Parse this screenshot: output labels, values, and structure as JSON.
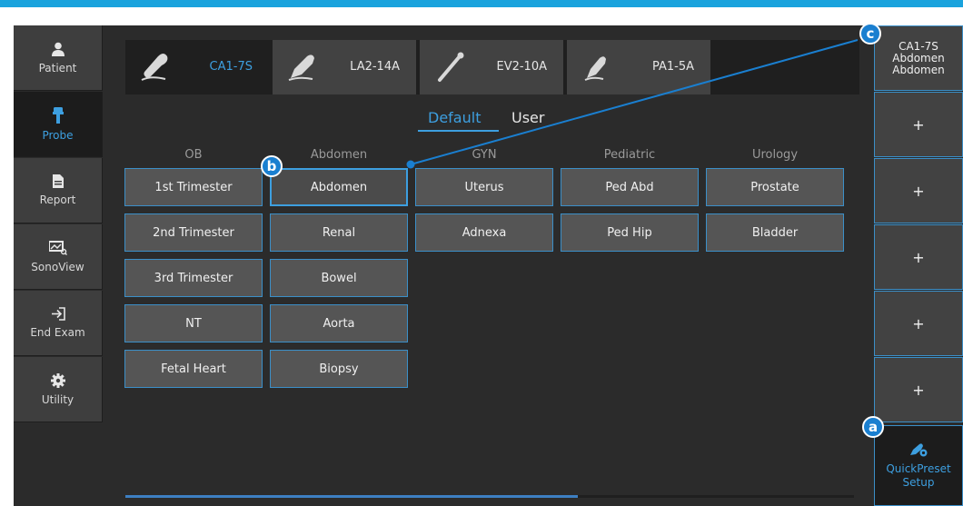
{
  "sidebar": {
    "items": [
      {
        "label": "Patient",
        "icon": "person-icon"
      },
      {
        "label": "Probe",
        "icon": "probe-icon"
      },
      {
        "label": "Report",
        "icon": "document-icon"
      },
      {
        "label": "SonoView",
        "icon": "sonoview-icon"
      },
      {
        "label": "End Exam",
        "icon": "exit-icon"
      },
      {
        "label": "Utility",
        "icon": "gear-icon"
      }
    ],
    "active": "Probe"
  },
  "probes": [
    {
      "name": "CA1-7S",
      "active": true
    },
    {
      "name": "LA2-14A",
      "active": false
    },
    {
      "name": "EV2-10A",
      "active": false
    },
    {
      "name": "PA1-5A",
      "active": false
    }
  ],
  "preset_tabs": {
    "default": "Default",
    "user": "User",
    "active": "Default"
  },
  "categories": [
    {
      "name": "OB",
      "presets": [
        "1st Trimester",
        "2nd Trimester",
        "3rd Trimester",
        "NT",
        "Fetal Heart"
      ]
    },
    {
      "name": "Abdomen",
      "presets": [
        "Abdomen",
        "Renal",
        "Bowel",
        "Aorta",
        "Biopsy"
      ]
    },
    {
      "name": "GYN",
      "presets": [
        "Uterus",
        "Adnexa"
      ]
    },
    {
      "name": "Pediatric",
      "presets": [
        "Ped Abd",
        "Ped Hip"
      ]
    },
    {
      "name": "Urology",
      "presets": [
        "Prostate",
        "Bladder"
      ]
    }
  ],
  "selected_preset": "Abdomen",
  "quick_preset": {
    "slot1": {
      "line1": "CA1-7S",
      "line2": "Abdomen",
      "line3": "Abdomen"
    },
    "empty_slot_label": "+",
    "setup_label_1": "QuickPreset",
    "setup_label_2": "Setup"
  },
  "callouts": {
    "a": "a",
    "b": "b",
    "c": "c"
  },
  "colors": {
    "accent": "#3d9fe0",
    "callout": "#1a7fd0",
    "topbar": "#1aa3dd"
  }
}
